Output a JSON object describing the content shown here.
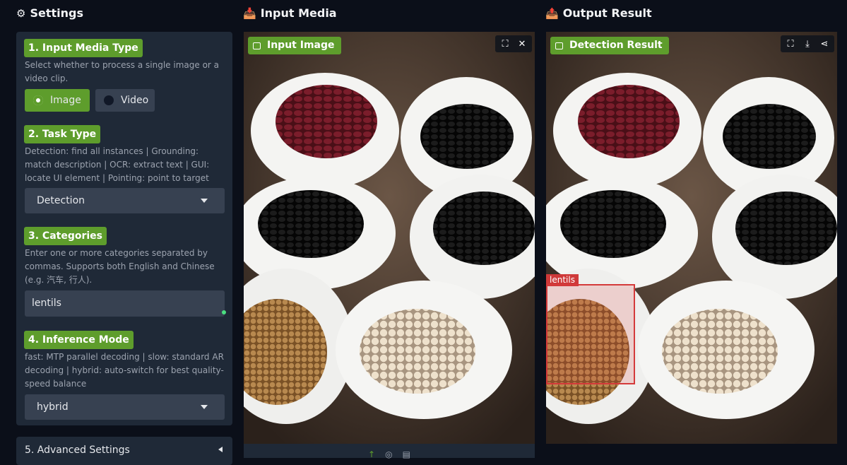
{
  "headers": {
    "settings": "Settings",
    "settings_icon": "gear-icon",
    "input_media": "Input Media",
    "input_icon": "inbox-tray-icon",
    "output_result": "Output Result",
    "output_icon": "outbox-tray-icon"
  },
  "settings": {
    "media_type": {
      "label": "1. Input Media Type",
      "description": "Select whether to process a single image or a video clip.",
      "options": [
        "Image",
        "Video"
      ],
      "selected": "Image"
    },
    "task_type": {
      "label": "2. Task Type",
      "description": "Detection: find all instances | Grounding: match description | OCR: extract text | GUI: locate UI element | Pointing: point to target",
      "value": "Detection"
    },
    "categories": {
      "label": "3. Categories",
      "description": "Enter one or more categories separated by commas. Supports both English and Chinese (e.g. 汽车, 行人).",
      "value": "lentils"
    },
    "inference_mode": {
      "label": "4. Inference Mode",
      "description": "fast: MTP parallel decoding | slow: standard AR decoding | hybrid: auto-switch for best quality-speed balance",
      "value": "hybrid"
    },
    "advanced": {
      "label": "5. Advanced Settings"
    }
  },
  "input_panel": {
    "badge": "Input Image",
    "tools": [
      "fullscreen-icon",
      "close-icon"
    ]
  },
  "output_panel": {
    "badge": "Detection Result",
    "tools": [
      "fullscreen-icon",
      "download-icon",
      "share-icon"
    ],
    "detection_label": "lentils"
  },
  "colors": {
    "accent": "#5e9d2c",
    "panel_bg": "#1f2937",
    "page_bg": "#0b0f19",
    "detection_box": "#d43a3a"
  }
}
